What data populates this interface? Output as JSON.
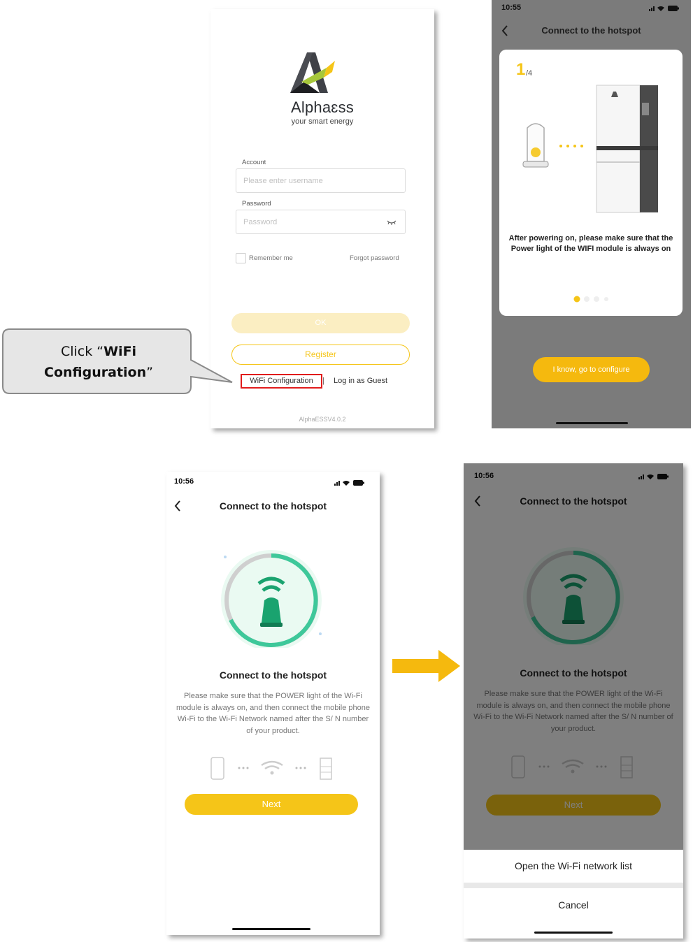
{
  "callout": {
    "prefix": "Click “",
    "bold": "WiFi Configuration",
    "suffix": "”"
  },
  "login": {
    "brand_name": "Alphaɛss",
    "brand_tagline": "your smart energy",
    "account_label": "Account",
    "username_placeholder": "Please enter username",
    "password_label": "Password",
    "password_placeholder": "Password",
    "remember_me": "Remember me",
    "forgot_password": "Forgot password",
    "ok_label": "OK",
    "register_label": "Register",
    "wifi_config_label": "WiFi Configuration",
    "separator": "|",
    "guest_label": "Log in as Guest",
    "version": "AlphaESSV4.0.2"
  },
  "guide": {
    "time": "10:55",
    "title": "Connect to the hotspot",
    "step_num": "1",
    "step_total": "/4",
    "text": "After powering on, please make sure that the Power light of the WIFI module is always on",
    "button": "I know, go to configure"
  },
  "hotspot": {
    "time": "10:56",
    "nav_title": "Connect to the hotspot",
    "heading": "Connect to the hotspot",
    "description": "Please make sure that the POWER light of the Wi-Fi module is always on, and then connect the mobile phone Wi-Fi to the Wi-Fi Network named after the S/ N number of your product.",
    "next": "Next"
  },
  "dialog": {
    "time": "10:56",
    "nav_title": "Connect to the hotspot",
    "heading": "Connect to the hotspot",
    "description": "Please make sure that the POWER light of the Wi-Fi module is always on, and then connect the mobile phone Wi-Fi to the Wi-Fi Network named after the S/ N number of your product.",
    "next": "Next",
    "open_wifi": "Open the Wi-Fi network list",
    "cancel": "Cancel"
  },
  "colors": {
    "accent": "#f5c518",
    "button_yellow": "#f5b90e",
    "highlight_red": "#e11b1b",
    "green": "#1aa36f"
  }
}
